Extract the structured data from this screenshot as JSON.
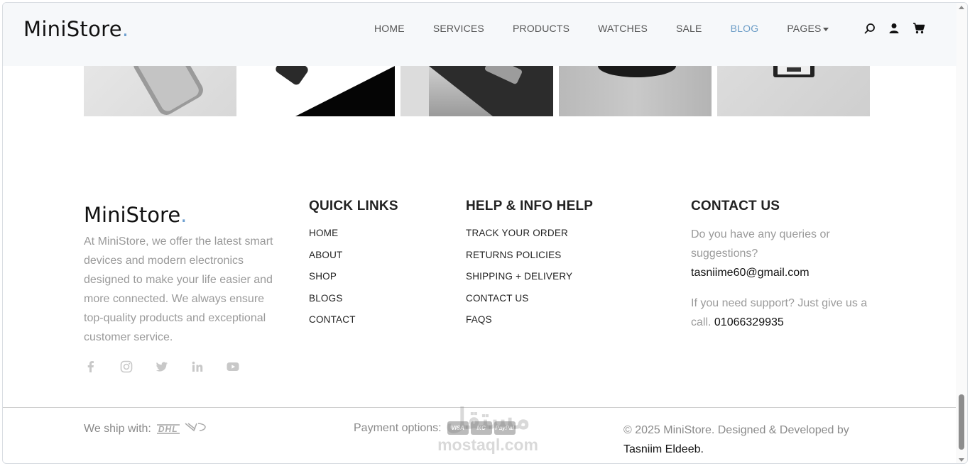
{
  "header": {
    "logo_text": "MiniStore",
    "logo_dot": ".",
    "nav": [
      {
        "label": "HOME"
      },
      {
        "label": "SERVICES"
      },
      {
        "label": "PRODUCTS"
      },
      {
        "label": "WATCHES"
      },
      {
        "label": "SALE"
      },
      {
        "label": "BLOG",
        "active": true
      },
      {
        "label": "PAGES"
      }
    ],
    "icons": [
      "search-icon",
      "user-icon",
      "cart-icon"
    ]
  },
  "colors": {
    "accent": "#6b9cc6",
    "header_bg": "#f6f8fa",
    "muted_text": "#9a9a9a"
  },
  "footer": {
    "brand": {
      "logo_text": "MiniStore",
      "logo_dot": ".",
      "description": "At MiniStore, we offer the latest smart devices and modern electronics designed to make your life easier and more connected. We always ensure top-quality products and exceptional customer service.",
      "social": [
        "facebook-icon",
        "instagram-icon",
        "twitter-icon",
        "linkedin-icon",
        "youtube-icon"
      ]
    },
    "quick_links": {
      "title": "QUICK LINKS",
      "items": [
        "HOME",
        "ABOUT",
        "SHOP",
        "BLOGS",
        "CONTACT"
      ]
    },
    "help": {
      "title": "HELP & INFO HELP",
      "items": [
        "TRACK YOUR ORDER",
        "RETURNS POLICIES",
        "SHIPPING + DELIVERY",
        "CONTACT US",
        "FAQS"
      ]
    },
    "contact": {
      "title": "CONTACT US",
      "queries_text": "Do you have any queries or suggestions?",
      "email": "tasniime60@gmail.com",
      "support_text": "If you need support? Just give us a call.",
      "phone": "01066329935"
    },
    "bottom": {
      "ship_label": "We ship with:",
      "ship_brands": [
        "DHL"
      ],
      "payment_label": "Payment options:",
      "payment_cards": [
        "VISA",
        "MC",
        "PayPal"
      ],
      "copyright": "© 2025 MiniStore. Designed & Developed by",
      "author": "Tasniim Eldeeb."
    }
  },
  "watermark": {
    "arabic": "مستقل",
    "latin": "mostaql.com"
  }
}
